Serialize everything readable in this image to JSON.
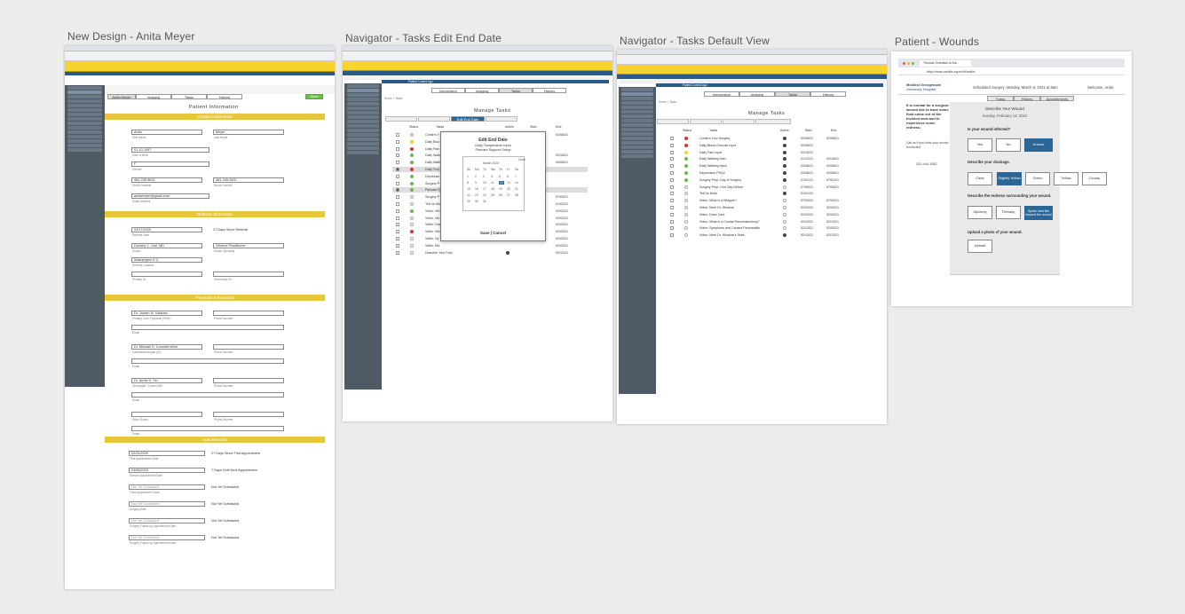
{
  "boards": [
    {
      "title": "New Design - Anita Meyer"
    },
    {
      "title": "Navigator - Tasks Edit End Date"
    },
    {
      "title": "Navigator - Tasks Default View"
    },
    {
      "title": "Patient - Wounds"
    }
  ],
  "design": {
    "top_tabs": [
      "Anita Meyer",
      "Imaging",
      "Tasks",
      "History"
    ],
    "save_label": "Save",
    "page_title": "Patient Information",
    "sections": [
      "Contact Information",
      "Referral Information",
      "Physician Information",
      "Appointments"
    ],
    "contact": {
      "first_name": "Anita",
      "first_name_label": "First Name",
      "last_name": "Meyer",
      "last_name_label": "Last Name",
      "dob": "01-10-1947",
      "dob_label": "Date of Birth",
      "gender": "F",
      "gender_label": "Gender",
      "mobile": "481-239-8632",
      "mobile_label": "Mobile Number",
      "home": "481-245-9432",
      "home_label": "Home Number",
      "email": "anitameyer@gmail.com",
      "email_label": "Email Address"
    },
    "referral": {
      "date": "03/17/2020",
      "date_label": "Referral Date",
      "since": "27 Days Since Referral",
      "doctor": "Dorothy C. Gail, MD",
      "doctor_label": "Doctor",
      "specialty": "General Practitioner",
      "specialty_label": "Doctor Specialty",
      "location": "Washington D.C.",
      "location_label": "Referral Location",
      "primary_dx_label": "Primary Dx",
      "secondary_dx_label": "Secondary Dx"
    },
    "physicians": [
      {
        "name": "Dr. Jordan M. Kalahan",
        "label": "Primary Care Physician (PMD)"
      },
      {
        "name": "Dr. Michael D. Counderrelum",
        "label": "Gastroenterologist (GI)"
      },
      {
        "name": "Dr. Annie H. Yin",
        "label": "Oncologist / Cancer MD"
      },
      {
        "name": "",
        "label": "Other Doctor"
      }
    ],
    "phone_label": "Phone Number",
    "email_label": "Email",
    "appointments": [
      {
        "value": "02/24/2020",
        "label": "First Appointment Date",
        "note": "27 Days Since First Appointment"
      },
      {
        "value": "03/08/2020",
        "label": "Second Appointment Date",
        "note": "7 Days Until Next Appointment"
      },
      {
        "value": "Not Yet Scheduled",
        "label": "Third Appointment Date",
        "note": "Not Yet Scheduled"
      },
      {
        "value": "Not Yet Scheduled",
        "label": "Surgery Date",
        "note": "Not Yet Scheduled"
      },
      {
        "value": "Not Yet Scheduled",
        "label": "Surgery Follow-up Appointment Date",
        "note": "Not Yet Scheduled"
      },
      {
        "value": "Not Yet Scheduled",
        "label": "Surgery Follow-up Appointment Date",
        "note": "Not Yet Scheduled"
      }
    ]
  },
  "navigator": {
    "app_bar": "Patient Control Ago",
    "top_tabs": [
      "Information",
      "Imaging",
      "Tasks",
      "History"
    ],
    "breadcrumb": "Home > Tasks",
    "title": "Manage Tasks",
    "edit_tab": "Edit End Date",
    "cols": {
      "status": "Status",
      "tasks": "Tasks",
      "active": "Active",
      "start": "Start",
      "end": "End"
    },
    "tasks_edit": [
      "Confirm Y",
      "Daily Bloo",
      "Daily Pain",
      "Daily Walk",
      "Daily Walk",
      "Daily Tem",
      "Depressio",
      "Surgery P",
      "Pancare S",
      "Surgery P",
      "Tell Us Mo",
      "Video: Wh",
      "Video: Ma",
      "Video: Dra",
      "Video: Wh",
      "Video: Sy",
      "Video: Ma",
      "Describe Your Pain"
    ],
    "end_edit": [
      "02/08/21",
      "",
      "",
      "02/16/21",
      "04/08/21",
      "",
      "",
      "",
      "",
      "07/05/21",
      "01/03/21",
      "02/03/21",
      "02/03/21",
      "02/03/21",
      "02/03/21",
      "02/03/21",
      "02/03/21",
      "02/12/21"
    ],
    "modal": {
      "title": "Edit End Date",
      "tasks": [
        "Daily Temperature Input",
        "Pancare Support Group"
      ],
      "month": "March 2020",
      "clear": "Clear",
      "weekdays": [
        "Su",
        "Mo",
        "Tu",
        "We",
        "Th",
        "Fr",
        "Sa"
      ],
      "days": [
        "1",
        "2",
        "3",
        "4",
        "5",
        "6",
        "7",
        "8",
        "9",
        "10",
        "11",
        "12",
        "13",
        "14",
        "15",
        "16",
        "17",
        "18",
        "19",
        "20",
        "21",
        "22",
        "23",
        "24",
        "25",
        "26",
        "27",
        "28",
        "29",
        "30",
        "31"
      ],
      "actions": "Save | Cancel"
    },
    "tasks_default": [
      {
        "name": "Confirm Your Surgery",
        "start": "02/08/21",
        "end": "02/08/21",
        "status": "#d93030"
      },
      {
        "name": "Daily Blood Glucose Input",
        "start": "02/08/21",
        "end": "",
        "status": "#d93030"
      },
      {
        "name": "Daily Pain Input",
        "start": "02/15/21",
        "end": "",
        "status": "#f3d22a"
      },
      {
        "name": "Daily Walking Inter",
        "start": "01/12/21",
        "end": "02/16/21",
        "status": "#6cb84a"
      },
      {
        "name": "Daily Walking Input",
        "start": "02/08/21",
        "end": "04/08/21",
        "status": "#6cb84a"
      },
      {
        "name": "Depression PHQ2",
        "start": "02/08/21",
        "end": "04/08/21",
        "status": "#6cb84a"
      },
      {
        "name": "Surgery Prep: Day of Surgery",
        "start": "07/01/21",
        "end": "07/01/21",
        "status": "#6cb84a"
      },
      {
        "name": "Surgery Prep: One Day Before",
        "start": "07/05/21",
        "end": "07/05/21",
        "status": ""
      },
      {
        "name": "Tell Us More",
        "start": "01/01/21",
        "end": "",
        "status": ""
      },
      {
        "name": "Video: What is a Whipple?",
        "start": "07/03/21",
        "end": "07/03/21",
        "status": ""
      },
      {
        "name": "Video: Meet Dr. Winslow",
        "start": "02/03/21",
        "end": "02/03/21",
        "status": ""
      },
      {
        "name": "Video: Drain Care",
        "start": "02/03/21",
        "end": "02/03/21",
        "status": ""
      },
      {
        "name": "Video: What is a Central Pancreatectomy?",
        "start": "02/13/21",
        "end": "02/13/21",
        "status": ""
      },
      {
        "name": "Video: Symptoms and Causes Pancreatitis",
        "start": "02/13/21",
        "end": "02/03/21",
        "status": ""
      },
      {
        "name": "Video: Meet Dr. Winslow's Team",
        "start": "02/13/21",
        "end": "02/13/21",
        "status": ""
      }
    ]
  },
  "wounds": {
    "browser_tab": "Thomas Schmalzi to Ma...",
    "url": "https://www.medila.org/en/rlt/hwflw/",
    "brand_line1": "Medilist Georgetown",
    "brand_line2": "University Hospital",
    "surgery": "Scheduled Surgery: Monday, March 8, 2021 at 8am",
    "welcome": "Welcome, Anita",
    "tabs": [
      "Today",
      "History",
      "Appointments"
    ],
    "side_text": "It is normal for a surgical wound site to have some fluid come out of the incision area and to experience some redness.",
    "side_call": "Call us if you think your wound is infected:",
    "phone": "202-444-1082",
    "heading": "Describe Your Wound",
    "date": "Sunday, February 14, 2021",
    "q1": "Is your wound infected?",
    "q1_opts": [
      "Yes",
      "No",
      "Unsure"
    ],
    "q2": "Describe your drainage.",
    "q2_opts": [
      "Clear",
      "Slightly Yellow",
      "Green",
      "Yellow",
      "Cloudy"
    ],
    "q3": "Describe the redness surrounding your wound.",
    "q3_opts": [
      "Splotchy",
      "Thready",
      "Spider web like beyond the wound"
    ],
    "q4": "Upload a photo of your wound.",
    "upload": "Upload"
  }
}
